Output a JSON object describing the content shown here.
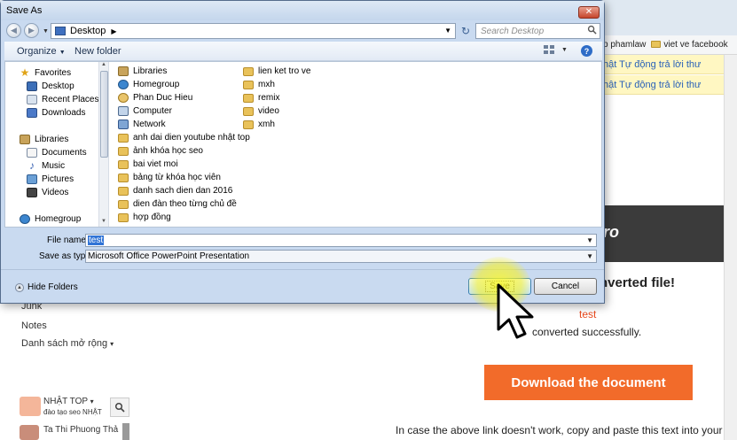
{
  "dialog": {
    "title": "Save As",
    "address": "Desktop",
    "search_placeholder": "Search Desktop",
    "toolbar": {
      "organize": "Organize",
      "new_folder": "New folder"
    },
    "nav_pane": {
      "favorites": {
        "header": "Favorites",
        "items": [
          "Desktop",
          "Recent Places",
          "Downloads"
        ]
      },
      "libraries": {
        "header": "Libraries",
        "items": [
          "Documents",
          "Music",
          "Pictures",
          "Videos"
        ]
      },
      "homegroup": "Homegroup"
    },
    "files_col1": [
      "Libraries",
      "Homegroup",
      "Phan Duc Hieu",
      "Computer",
      "Network",
      "anh dai dien youtube nhật top",
      "ảnh khóa học seo",
      "bai viet moi",
      "bảng từ khóa học viên",
      "danh sach dien dan 2016",
      "dien đàn theo từng chủ đề",
      "hợp đồng"
    ],
    "files_col2": [
      "lien ket tro ve",
      "mxh",
      "remix",
      "video",
      "xmh"
    ],
    "file_name_label": "File name:",
    "file_name_value": "test",
    "save_type_label": "Save as type:",
    "save_type_value": "Microsoft Office PowerPoint Presentation",
    "hide_folders": "Hide Folders",
    "save_button": "Save",
    "cancel_button": "Cancel"
  },
  "background": {
    "bookmarks": [
      "p phamlaw",
      "viet ve facebook"
    ],
    "mail_rows": [
      "hật Tự động trả lời thư",
      "hật Tự động trả lời thư"
    ],
    "banner_suffix": "ro",
    "converted_title": "nverted file!",
    "test_label": "test",
    "converted_text": "converted successfully.",
    "download_button": "Download the document",
    "footer_text": "In case the above link doesn't work, copy and paste this text into your",
    "left_items": [
      "Junk",
      "Notes",
      "Danh sách mở rộng"
    ],
    "profile": {
      "name": "NHẬT TOP",
      "subtitle": "đào tạo seo NHẬT",
      "name2": "Ta Thi Phuong Thả"
    }
  },
  "colors": {
    "dialog_bg": "#c9daf0",
    "download_button": "#f26b2a",
    "test_text": "#e8481c",
    "mail_highlight": "#fff7c2"
  }
}
